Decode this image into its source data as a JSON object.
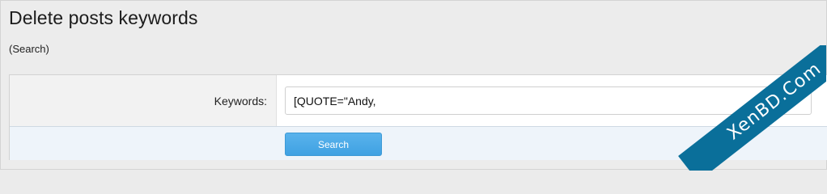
{
  "page": {
    "title": "Delete posts keywords",
    "subtitle": "(Search)"
  },
  "form": {
    "keywords_label": "Keywords:",
    "keywords_value": "[QUOTE=\"Andy,",
    "search_button_label": "Search"
  },
  "watermark": {
    "text": "XenBD.Com",
    "color": "#0a6f9a"
  },
  "colors": {
    "button": "#4aa9e8",
    "submit_row": "#eef4fa"
  }
}
